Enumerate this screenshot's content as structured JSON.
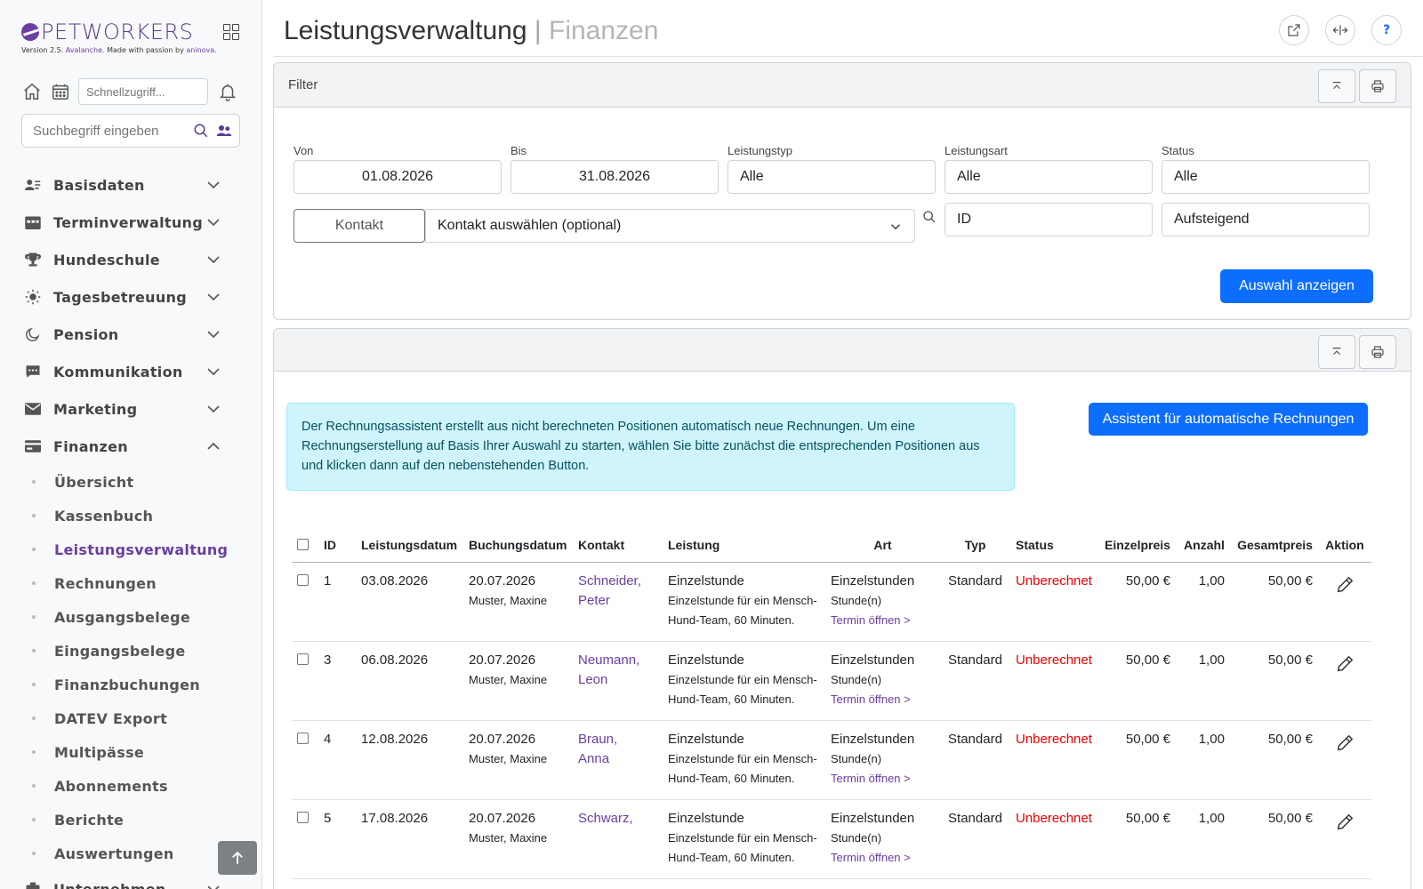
{
  "brand": {
    "name": "PETWORKERS",
    "version_prefix": "Version 2.5.",
    "version_name": "Avalanche.",
    "made_with": "Made with passion by",
    "maker": "aninova."
  },
  "quick": {
    "placeholder": "Schnellzugriff..."
  },
  "search": {
    "placeholder": "Suchbegriff eingeben"
  },
  "nav": {
    "items": [
      {
        "label": "Basisdaten",
        "icon": "contacts-icon"
      },
      {
        "label": "Terminverwaltung",
        "icon": "calendar-icon"
      },
      {
        "label": "Hundeschule",
        "icon": "trophy-icon"
      },
      {
        "label": "Tagesbetreuung",
        "icon": "sun-icon"
      },
      {
        "label": "Pension",
        "icon": "moon-icon"
      },
      {
        "label": "Kommunikation",
        "icon": "chat-icon"
      },
      {
        "label": "Marketing",
        "icon": "envelope-icon"
      },
      {
        "label": "Finanzen",
        "icon": "wallet-icon"
      }
    ],
    "finanzen_sub": [
      "Übersicht",
      "Kassenbuch",
      "Leistungsverwaltung",
      "Rechnungen",
      "Ausgangsbelege",
      "Eingangsbelege",
      "Finanzbuchungen",
      "DATEV Export",
      "Multipässe",
      "Abonnements",
      "Berichte",
      "Auswertungen"
    ],
    "active_sub": "Leistungsverwaltung",
    "next_item": "Unternehmen"
  },
  "page": {
    "title": "Leistungsverwaltung",
    "separator": "|",
    "subtitle": "Finanzen",
    "help_label": "?"
  },
  "filter": {
    "header": "Filter",
    "von_label": "Von",
    "von_value": "01.08.2026",
    "bis_label": "Bis",
    "bis_value": "31.08.2026",
    "typ_label": "Leistungstyp",
    "typ_value": "Alle",
    "art_label": "Leistungsart",
    "art_value": "Alle",
    "status_label": "Status",
    "status_value": "Alle",
    "kontakt_button": "Kontakt",
    "kontakt_select": "Kontakt auswählen (optional)",
    "sort_field": "ID",
    "sort_order": "Aufsteigend",
    "submit": "Auswahl anzeigen"
  },
  "results": {
    "info": "Der Rechnungsassistent erstellt aus nicht berechneten Positionen automatisch neue Rechnungen. Um eine Rechnungserstellung auf Basis Ihrer Auswahl zu starten, wählen Sie bitte zunächst die entsprechenden Positionen aus und klicken dann auf den nebenstehenden Button.",
    "assistant_button": "Assistent für automatische Rechnungen",
    "columns": [
      "ID",
      "Leistungsdatum",
      "Buchungsdatum",
      "Kontakt",
      "Leistung",
      "Art",
      "Typ",
      "Status",
      "Einzelpreis",
      "Anzahl",
      "Gesamtpreis",
      "Aktion"
    ],
    "rows": [
      {
        "id": "1",
        "leistungsdatum": "03.08.2026",
        "buchungsdatum": "20.07.2026",
        "bucher": "Muster, Maxine",
        "kontakt_1": "Schneider,",
        "kontakt_2": "Peter",
        "leistung": "Einzelstunde",
        "leistung_desc": "Einzelstunde für ein Mensch-Hund-Team, 60 Minuten.",
        "art": "Einzelstunden",
        "einheit": "Stunde(n)",
        "termin_link": "Termin öffnen >",
        "typ": "Standard",
        "status": "Unberechnet",
        "einzelpreis": "50,00 €",
        "anzahl": "1,00",
        "gesamtpreis": "50,00 €"
      },
      {
        "id": "3",
        "leistungsdatum": "06.08.2026",
        "buchungsdatum": "20.07.2026",
        "bucher": "Muster, Maxine",
        "kontakt_1": "Neumann,",
        "kontakt_2": "Leon",
        "leistung": "Einzelstunde",
        "leistung_desc": "Einzelstunde für ein Mensch-Hund-Team, 60 Minuten.",
        "art": "Einzelstunden",
        "einheit": "Stunde(n)",
        "termin_link": "Termin öffnen >",
        "typ": "Standard",
        "status": "Unberechnet",
        "einzelpreis": "50,00 €",
        "anzahl": "1,00",
        "gesamtpreis": "50,00 €"
      },
      {
        "id": "4",
        "leistungsdatum": "12.08.2026",
        "buchungsdatum": "20.07.2026",
        "bucher": "Muster, Maxine",
        "kontakt_1": "Braun,",
        "kontakt_2": "Anna",
        "leistung": "Einzelstunde",
        "leistung_desc": "Einzelstunde für ein Mensch-Hund-Team, 60 Minuten.",
        "art": "Einzelstunden",
        "einheit": "Stunde(n)",
        "termin_link": "Termin öffnen >",
        "typ": "Standard",
        "status": "Unberechnet",
        "einzelpreis": "50,00 €",
        "anzahl": "1,00",
        "gesamtpreis": "50,00 €"
      },
      {
        "id": "5",
        "leistungsdatum": "17.08.2026",
        "buchungsdatum": "20.07.2026",
        "bucher": "Muster, Maxine",
        "kontakt_1": "Schwarz,",
        "kontakt_2": "",
        "leistung": "Einzelstunde",
        "leistung_desc": "Einzelstunde für ein Mensch-Hund-Team, 60 Minuten.",
        "art": "Einzelstunden",
        "einheit": "Stunde(n)",
        "termin_link": "Termin öffnen >",
        "typ": "Standard",
        "status": "Unberechnet",
        "einzelpreis": "50,00 €",
        "anzahl": "1,00",
        "gesamtpreis": "50,00 €"
      }
    ]
  },
  "colors": {
    "brand_purple": "#6a3fa0",
    "primary_blue": "#0d6efd",
    "status_red": "#ee0000",
    "info_bg": "#cff4fc"
  }
}
